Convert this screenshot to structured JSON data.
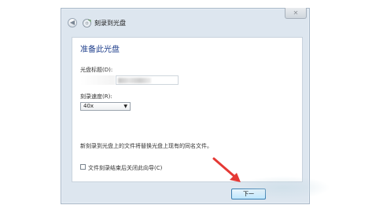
{
  "window": {
    "title": "刻录到光盘",
    "close_glyph": "✕",
    "back_glyph": "◀"
  },
  "content": {
    "heading": "准备此光盘",
    "disc_title_label": "光盘标题(D):",
    "speed_label": "刻录速度(R):",
    "speed_value": "40x",
    "info_text": "新刻录到光盘上的文件将替换光盘上现有的同名文件。",
    "close_wizard_label": "文件刻录结束后关闭此向导(C)"
  },
  "footer": {
    "next_label": "下一"
  },
  "colors": {
    "heading": "#1f3f8c",
    "window_frame": "#dde6ef",
    "arrow": "#e53935"
  }
}
